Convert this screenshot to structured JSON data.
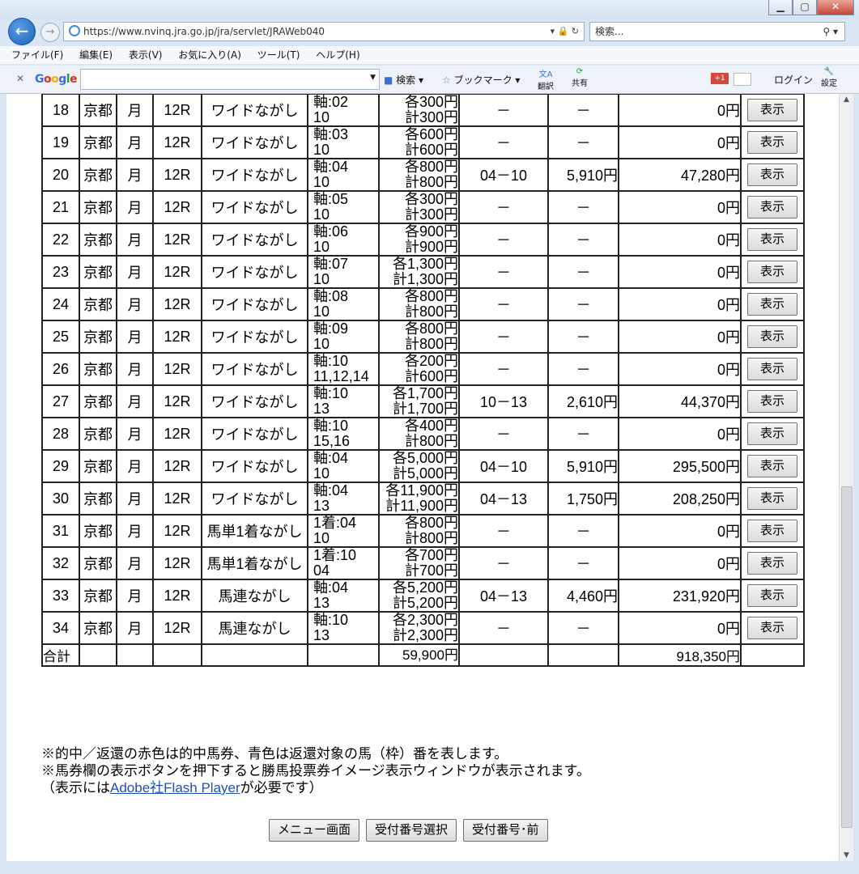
{
  "browser": {
    "url": "https://www.nvinq.jra.go.jp/jra/servlet/JRAWeb040",
    "search_placeholder": "検索...",
    "menu": [
      "ファイル(F)",
      "編集(E)",
      "表示(V)",
      "お気に入り(A)",
      "ツール(T)",
      "ヘルプ(H)"
    ],
    "google_toolbar": {
      "logo": "Google",
      "search_label": "検索",
      "bookmark_label": "ブックマーク",
      "translate_label": "翻訳",
      "share_label": "共有",
      "login_label": "ログイン",
      "settings_label": "設定"
    }
  },
  "rows": [
    {
      "no": "18",
      "place": "京都",
      "day": "月",
      "race": "12R",
      "type": "ワイドながし",
      "horse1": "軸:02",
      "horse2": "10",
      "amt1": "各300円",
      "amt2": "計300円",
      "hit": "－",
      "payout": "－",
      "ret": "0円",
      "btn": "表示"
    },
    {
      "no": "19",
      "place": "京都",
      "day": "月",
      "race": "12R",
      "type": "ワイドながし",
      "horse1": "軸:03",
      "horse2": "10",
      "amt1": "各600円",
      "amt2": "計600円",
      "hit": "－",
      "payout": "－",
      "ret": "0円",
      "btn": "表示"
    },
    {
      "no": "20",
      "place": "京都",
      "day": "月",
      "race": "12R",
      "type": "ワイドながし",
      "horse1": "軸:04",
      "horse2": "10",
      "amt1": "各800円",
      "amt2": "計800円",
      "hit": "04－10",
      "payout": "5,910円",
      "ret": "47,280円",
      "btn": "表示"
    },
    {
      "no": "21",
      "place": "京都",
      "day": "月",
      "race": "12R",
      "type": "ワイドながし",
      "horse1": "軸:05",
      "horse2": "10",
      "amt1": "各300円",
      "amt2": "計300円",
      "hit": "－",
      "payout": "－",
      "ret": "0円",
      "btn": "表示"
    },
    {
      "no": "22",
      "place": "京都",
      "day": "月",
      "race": "12R",
      "type": "ワイドながし",
      "horse1": "軸:06",
      "horse2": "10",
      "amt1": "各900円",
      "amt2": "計900円",
      "hit": "－",
      "payout": "－",
      "ret": "0円",
      "btn": "表示"
    },
    {
      "no": "23",
      "place": "京都",
      "day": "月",
      "race": "12R",
      "type": "ワイドながし",
      "horse1": "軸:07",
      "horse2": "10",
      "amt1": "各1,300円",
      "amt2": "計1,300円",
      "hit": "－",
      "payout": "－",
      "ret": "0円",
      "btn": "表示"
    },
    {
      "no": "24",
      "place": "京都",
      "day": "月",
      "race": "12R",
      "type": "ワイドながし",
      "horse1": "軸:08",
      "horse2": "10",
      "amt1": "各800円",
      "amt2": "計800円",
      "hit": "－",
      "payout": "－",
      "ret": "0円",
      "btn": "表示"
    },
    {
      "no": "25",
      "place": "京都",
      "day": "月",
      "race": "12R",
      "type": "ワイドながし",
      "horse1": "軸:09",
      "horse2": "10",
      "amt1": "各800円",
      "amt2": "計800円",
      "hit": "－",
      "payout": "－",
      "ret": "0円",
      "btn": "表示"
    },
    {
      "no": "26",
      "place": "京都",
      "day": "月",
      "race": "12R",
      "type": "ワイドながし",
      "horse1": "軸:10",
      "horse2": "11,12,14",
      "amt1": "各200円",
      "amt2": "計600円",
      "hit": "－",
      "payout": "－",
      "ret": "0円",
      "btn": "表示"
    },
    {
      "no": "27",
      "place": "京都",
      "day": "月",
      "race": "12R",
      "type": "ワイドながし",
      "horse1": "軸:10",
      "horse2": "13",
      "amt1": "各1,700円",
      "amt2": "計1,700円",
      "hit": "10－13",
      "payout": "2,610円",
      "ret": "44,370円",
      "btn": "表示"
    },
    {
      "no": "28",
      "place": "京都",
      "day": "月",
      "race": "12R",
      "type": "ワイドながし",
      "horse1": "軸:10",
      "horse2": "15,16",
      "amt1": "各400円",
      "amt2": "計800円",
      "hit": "－",
      "payout": "－",
      "ret": "0円",
      "btn": "表示"
    },
    {
      "no": "29",
      "place": "京都",
      "day": "月",
      "race": "12R",
      "type": "ワイドながし",
      "horse1": "軸:04",
      "horse2": "10",
      "amt1": "各5,000円",
      "amt2": "計5,000円",
      "hit": "04－10",
      "payout": "5,910円",
      "ret": "295,500円",
      "btn": "表示"
    },
    {
      "no": "30",
      "place": "京都",
      "day": "月",
      "race": "12R",
      "type": "ワイドながし",
      "horse1": "軸:04",
      "horse2": "13",
      "amt1": "各11,900円",
      "amt2": "計11,900円",
      "hit": "04－13",
      "payout": "1,750円",
      "ret": "208,250円",
      "btn": "表示"
    },
    {
      "no": "31",
      "place": "京都",
      "day": "月",
      "race": "12R",
      "type": "馬単1着ながし",
      "horse1": "1着:04",
      "horse2": "10",
      "amt1": "各800円",
      "amt2": "計800円",
      "hit": "－",
      "payout": "－",
      "ret": "0円",
      "btn": "表示"
    },
    {
      "no": "32",
      "place": "京都",
      "day": "月",
      "race": "12R",
      "type": "馬単1着ながし",
      "horse1": "1着:10",
      "horse2": "04",
      "amt1": "各700円",
      "amt2": "計700円",
      "hit": "－",
      "payout": "－",
      "ret": "0円",
      "btn": "表示"
    },
    {
      "no": "33",
      "place": "京都",
      "day": "月",
      "race": "12R",
      "type": "馬連ながし",
      "horse1": "軸:04",
      "horse2": "13",
      "amt1": "各5,200円",
      "amt2": "計5,200円",
      "hit": "04－13",
      "payout": "4,460円",
      "ret": "231,920円",
      "btn": "表示"
    },
    {
      "no": "34",
      "place": "京都",
      "day": "月",
      "race": "12R",
      "type": "馬連ながし",
      "horse1": "軸:10",
      "horse2": "13",
      "amt1": "各2,300円",
      "amt2": "計2,300円",
      "hit": "－",
      "payout": "－",
      "ret": "0円",
      "btn": "表示"
    }
  ],
  "totals": {
    "label": "合計",
    "amount": "59,900円",
    "return": "918,350円"
  },
  "notes": {
    "line1": "※的中／返還の赤色は的中馬券、青色は返還対象の馬（枠）番を表します。",
    "line2": "※馬券欄の表示ボタンを押下すると勝馬投票券イメージ表示ウィンドウが表示されます。",
    "line3_pre": "（表示には",
    "line3_link": "Adobe社Flash Player",
    "line3_post": "が必要です）"
  },
  "buttons": {
    "menu": "メニュー画面",
    "select": "受付番号選択",
    "prev": "受付番号･前"
  }
}
